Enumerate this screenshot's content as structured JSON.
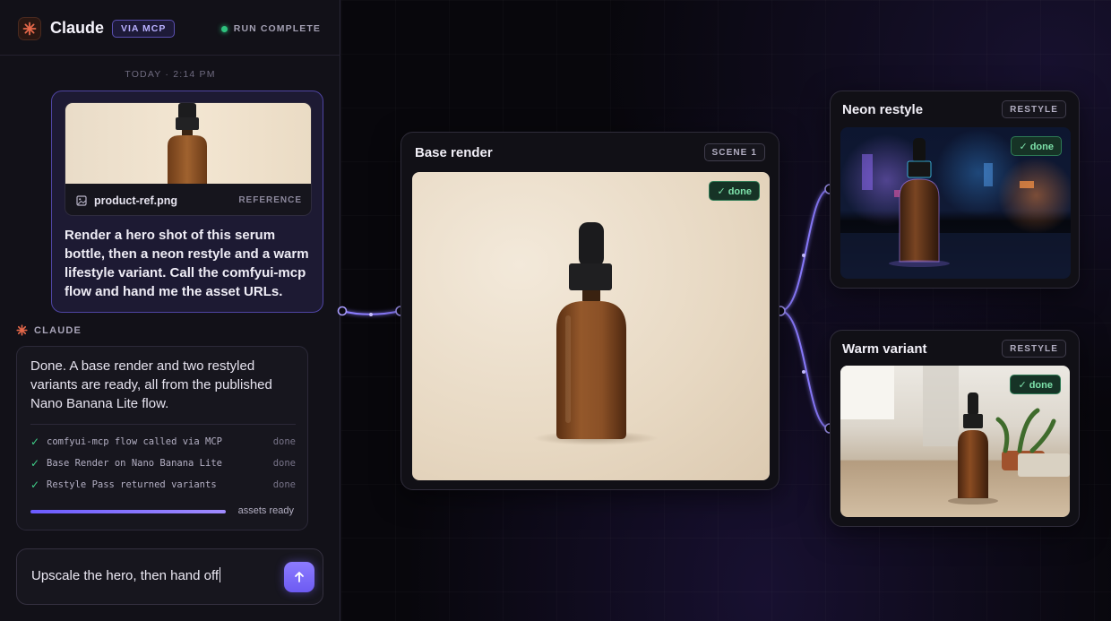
{
  "header": {
    "app_title": "Claude",
    "via_badge": "VIA MCP",
    "run_status": "RUN COMPLETE",
    "status_color": "#2ec27e"
  },
  "chat": {
    "timestamp": "TODAY · 2:14 PM",
    "user_message": {
      "attachment": {
        "file_name": "product-ref.png",
        "tag": "REFERENCE",
        "icon": "image-icon"
      },
      "text": "Render a hero shot of this serum bottle, then a neon restyle and a warm lifestyle variant. Call the comfyui-mcp flow and hand me the asset URLs."
    },
    "assistant_label": "CLAUDE",
    "assistant_message": {
      "text": "Done. A base render and two restyled variants are ready, all from the published Nano Banana Lite flow.",
      "steps": [
        {
          "label": "comfyui-mcp flow called via MCP",
          "status": "done"
        },
        {
          "label": "Base Render on Nano Banana Lite",
          "status": "done"
        },
        {
          "label": "Restyle Pass returned variants",
          "status": "done"
        }
      ],
      "progress_label": "assets ready",
      "progress_fraction": 1.0
    },
    "composer": {
      "value": "Upscale the hero, then hand off",
      "send_icon": "arrow-up-icon"
    }
  },
  "canvas": {
    "accent_color": "#8b7bff",
    "nodes": {
      "base": {
        "title": "Base render",
        "tag": "SCENE 1",
        "status": "✓ done"
      },
      "neon": {
        "title": "Neon restyle",
        "tag": "RESTYLE",
        "status": "✓ done"
      },
      "warm": {
        "title": "Warm variant",
        "tag": "RESTYLE",
        "status": "✓ done"
      }
    }
  }
}
